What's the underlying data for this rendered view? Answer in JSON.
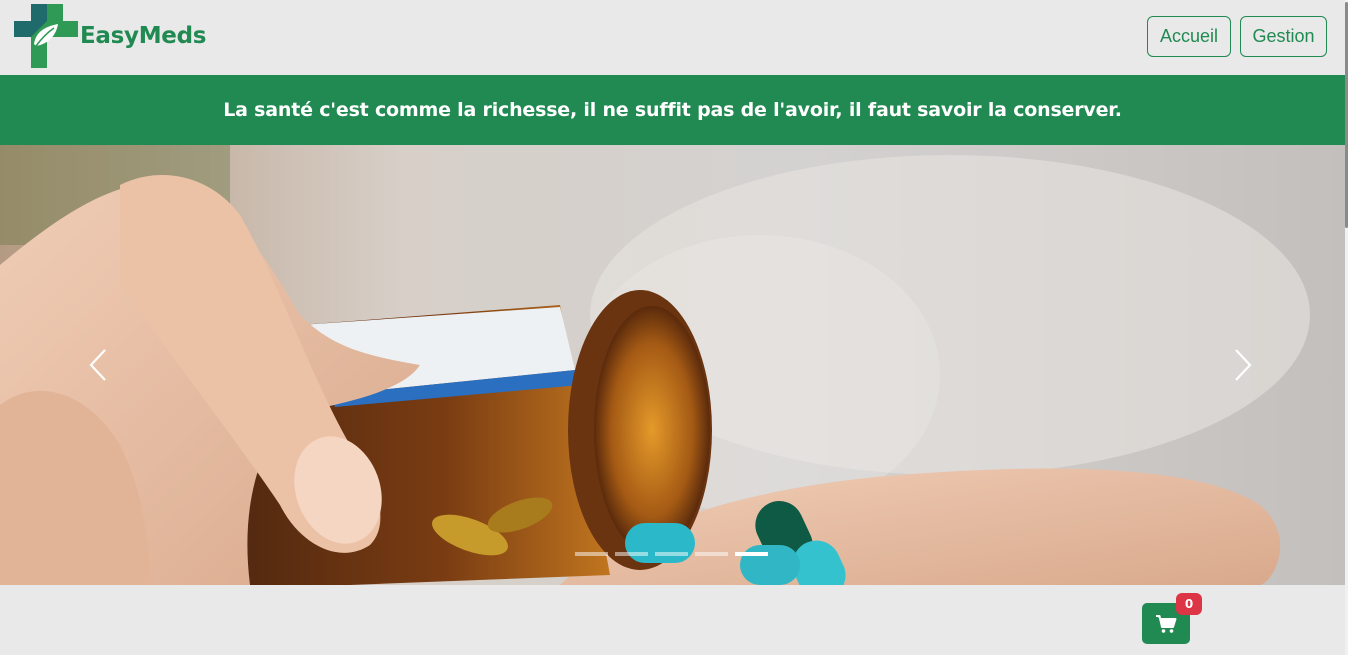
{
  "brand": {
    "name": "EasyMeds",
    "logo_icon": "medical-cross-leaf-icon"
  },
  "nav": {
    "items": [
      {
        "label": "Accueil"
      },
      {
        "label": "Gestion"
      }
    ]
  },
  "banner": {
    "quote": "La santé c'est comme la richesse, il ne suffit pas de l'avoir, il faut savoir la conserver."
  },
  "carousel": {
    "slide_image": "hand-pouring-capsules-from-amber-pill-bottle",
    "prev_icon": "chevron-left-icon",
    "next_icon": "chevron-right-icon",
    "slide_count": 5,
    "active_index": 4
  },
  "cart": {
    "icon": "shopping-cart-icon",
    "count": "0"
  },
  "colors": {
    "primary": "#218a52",
    "badge": "#dc3545",
    "background": "#e9e9e9"
  }
}
